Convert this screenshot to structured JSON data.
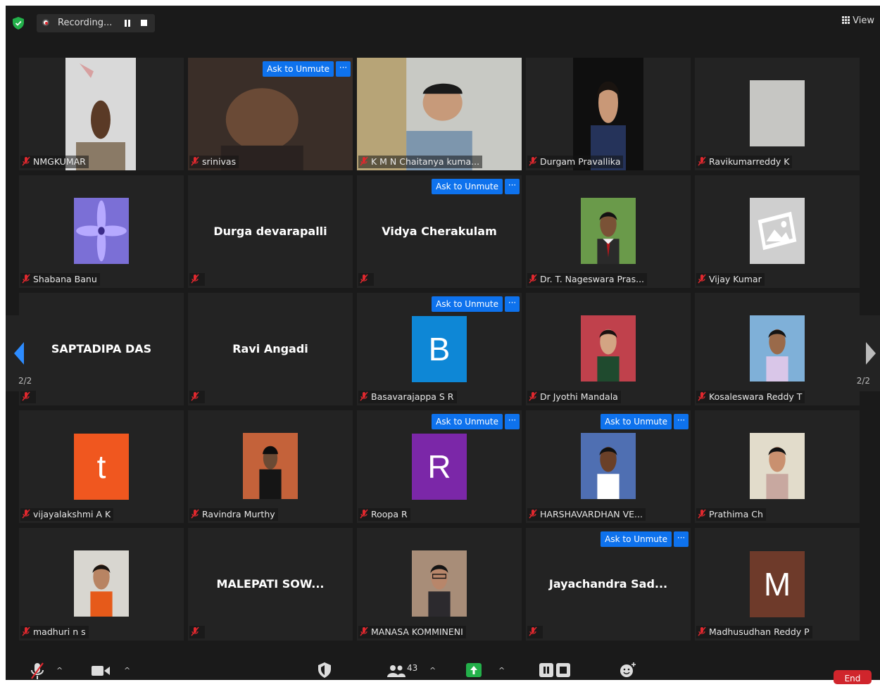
{
  "top_bar": {
    "recording_label": "Recording...",
    "view_label": "View"
  },
  "paging": {
    "left_page": "2/2",
    "right_page": "2/2"
  },
  "tiles": [
    {
      "name": "NMGKUMAR",
      "display": "video"
    },
    {
      "name": "srinivas",
      "display": "video",
      "ask_to_unmute": "Ask to Unmute",
      "more": "···"
    },
    {
      "name": "K M N Chaitanya kuma...",
      "display": "video"
    },
    {
      "name": "Durgam Pravallika",
      "display": "video"
    },
    {
      "name": "Ravikumarreddy K",
      "display": "photo"
    },
    {
      "name": "Shabana Banu",
      "display": "photo"
    },
    {
      "name": "",
      "display": "name",
      "big_name": "Durga devarapalli"
    },
    {
      "name": "",
      "display": "name",
      "big_name": "Vidya Cherakulam",
      "ask_to_unmute": "Ask to Unmute",
      "more": "···"
    },
    {
      "name": "Dr. T. Nageswara Pras...",
      "display": "photo"
    },
    {
      "name": "Vijay Kumar",
      "display": "photo"
    },
    {
      "name": "",
      "display": "name",
      "big_name": "SAPTADIPA DAS"
    },
    {
      "name": "",
      "display": "name",
      "big_name": "Ravi Angadi"
    },
    {
      "name": "Basavarajappa S R",
      "display": "letter",
      "letter": "B",
      "letter_color": "#0e87d6",
      "ask_to_unmute": "Ask to Unmute",
      "more": "···"
    },
    {
      "name": "Dr Jyothi Mandala",
      "display": "photo"
    },
    {
      "name": "Kosaleswara Reddy T",
      "display": "photo"
    },
    {
      "name": "vijayalakshmi A K",
      "display": "letter",
      "letter": "t",
      "letter_color": "#f0571f"
    },
    {
      "name": "Ravindra Murthy",
      "display": "photo"
    },
    {
      "name": "Roopa R",
      "display": "letter",
      "letter": "R",
      "letter_color": "#7b27a8",
      "ask_to_unmute": "Ask to Unmute",
      "more": "···"
    },
    {
      "name": "HARSHAVARDHAN VE...",
      "display": "photo",
      "ask_to_unmute": "Ask to Unmute",
      "more": "···"
    },
    {
      "name": "Prathima Ch",
      "display": "photo"
    },
    {
      "name": "madhuri n s",
      "display": "photo"
    },
    {
      "name": "",
      "display": "name",
      "big_name": "MALEPATI  SOW..."
    },
    {
      "name": "MANASA KOMMINENI",
      "display": "photo"
    },
    {
      "name": "",
      "display": "name",
      "big_name": "Jayachandra Sad...",
      "ask_to_unmute": "Ask to Unmute",
      "more": "···"
    },
    {
      "name": "Madhusudhan Reddy P",
      "display": "letter",
      "letter": "M",
      "letter_color": "#6e3a2a"
    }
  ],
  "toolbar": {
    "participants_count": "43",
    "end_label": "End"
  },
  "colors": {
    "accent": "#0e72ed",
    "mic_muted": "#e0282e",
    "security_green": "#23b04a",
    "end_red": "#d0252c"
  }
}
